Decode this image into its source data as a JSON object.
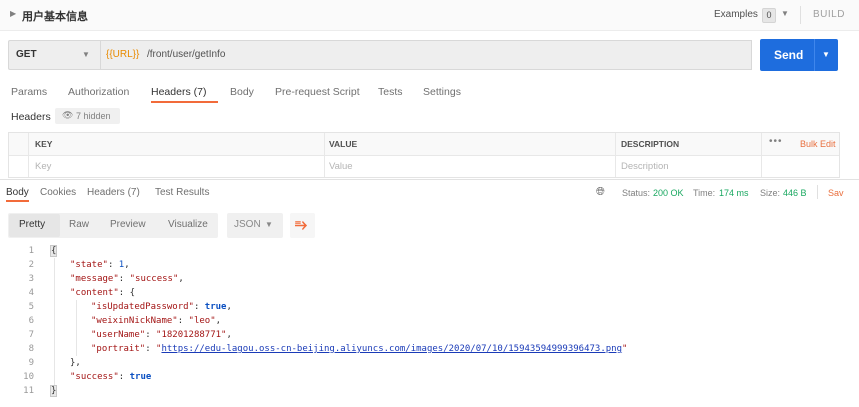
{
  "request": {
    "name": "用户基本信息"
  },
  "examples": {
    "label": "Examples",
    "count": "0"
  },
  "build_label": "BUILD",
  "urlbar": {
    "method": "GET",
    "url_var": "{{URL}}",
    "url_path": "/front/user/getInfo",
    "send_label": "Send"
  },
  "request_tabs": {
    "params": "Params",
    "authorization": "Authorization",
    "headers": "Headers (7)",
    "body": "Body",
    "prerequest": "Pre-request Script",
    "tests": "Tests",
    "settings": "Settings"
  },
  "headers_section": {
    "title": "Headers",
    "hidden": "7 hidden",
    "columns": {
      "key": "KEY",
      "value": "VALUE",
      "description": "DESCRIPTION"
    },
    "placeholders": {
      "key": "Key",
      "value": "Value",
      "description": "Description"
    },
    "bulk_edit": "Bulk Edit",
    "more": "•••"
  },
  "response_tabs": {
    "body": "Body",
    "cookies": "Cookies",
    "headers": "Headers (7)",
    "test_results": "Test Results"
  },
  "status": {
    "status_key": "Status:",
    "status_val": "200 OK",
    "time_key": "Time:",
    "time_val": "174 ms",
    "size_key": "Size:",
    "size_val": "446 B",
    "save": "Sav"
  },
  "format_bar": {
    "pretty": "Pretty",
    "raw": "Raw",
    "preview": "Preview",
    "visualize": "Visualize",
    "json": "JSON"
  },
  "code": {
    "line_numbers": [
      "1",
      "2",
      "3",
      "4",
      "5",
      "6",
      "7",
      "8",
      "9",
      "10",
      "11"
    ],
    "open_brace": "{",
    "state_key": "\"state\"",
    "state_val": "1",
    "message_key": "\"message\"",
    "message_val": "\"success\"",
    "content_key": "\"content\"",
    "content_open": "{",
    "isUpdated_key": "\"isUpdatedPassword\"",
    "isUpdated_val": "true",
    "nick_key": "\"weixinNickName\"",
    "nick_val": "\"leo\"",
    "user_key": "\"userName\"",
    "user_val": "\"18201288771\"",
    "portrait_key": "\"portrait\"",
    "portrait_q1": "\"",
    "portrait_url": "https://edu-lagou.oss-cn-beijing.aliyuncs.com/images/2020/07/10/15943594999396473.png",
    "portrait_q2": "\"",
    "content_close": "},",
    "success_key": "\"success\"",
    "success_val": "true",
    "close_brace": "}"
  },
  "colors": {
    "accent": "#f26b3a",
    "send_blue": "#1e6dde",
    "status_green": "#19a860",
    "url_var_orange": "#e88a00"
  }
}
